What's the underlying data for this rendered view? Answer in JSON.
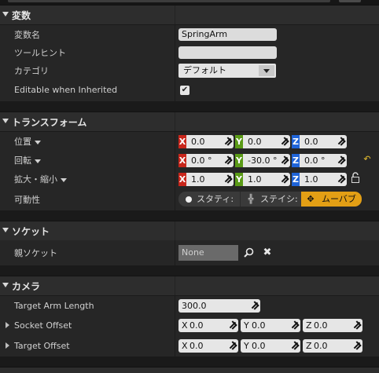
{
  "sections": {
    "variable": {
      "title": "変数",
      "rows": {
        "name": {
          "label": "変数名",
          "value": "SpringArm"
        },
        "tooltip": {
          "label": "ツールヒント",
          "value": ""
        },
        "category": {
          "label": "カテゴリ",
          "value": "デフォルト"
        },
        "editable": {
          "label": "Editable when Inherited",
          "checked": true
        }
      }
    },
    "transform": {
      "title": "トランスフォーム",
      "location": {
        "label": "位置",
        "x": "0.0",
        "y": "0.0",
        "z": "0.0"
      },
      "rotation": {
        "label": "回転",
        "x": "0.0 °",
        "y": "-30.0 °",
        "z": "0.0 °"
      },
      "scale": {
        "label": "拡大・縮小",
        "x": "1.0",
        "y": "1.0",
        "z": "1.0"
      },
      "mobility": {
        "label": "可動性",
        "options": [
          "スタティ:",
          "ステイシ:",
          "ムーバブ"
        ],
        "selected": "ムーバブ"
      }
    },
    "socket": {
      "title": "ソケット",
      "parent": {
        "label": "親ソケット",
        "value": "None"
      }
    },
    "camera": {
      "title": "カメラ",
      "arm_length": {
        "label": "Target Arm Length",
        "value": "300.0"
      },
      "socket_offset": {
        "label": "Socket Offset",
        "x": "0.0",
        "y": "0.0",
        "z": "0.0"
      },
      "target_offset": {
        "label": "Target Offset",
        "x": "0.0",
        "y": "0.0",
        "z": "0.0"
      }
    }
  },
  "axis_letters": {
    "x": "X",
    "y": "Y",
    "z": "Z"
  },
  "colors": {
    "x_axis": "#c8261b",
    "y_axis": "#5a9a16",
    "z_axis": "#1f64d8",
    "mobility_active": "#e39f15",
    "reset": "#e8c030"
  },
  "icons": [
    "dropdown-icon",
    "reset-icon",
    "lock-icon",
    "dot-icon",
    "static-icon",
    "stationary-icon",
    "movable-icon",
    "search-icon",
    "clear-icon",
    "expand-arrow-icon"
  ]
}
